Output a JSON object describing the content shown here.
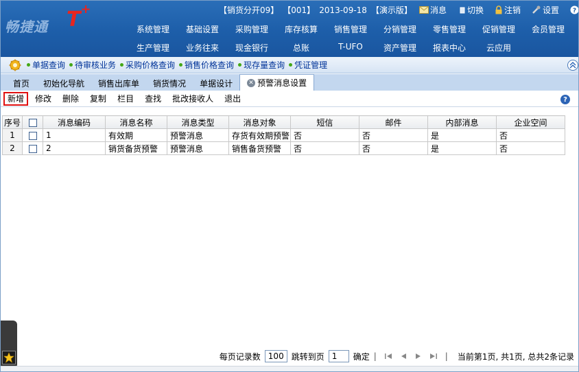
{
  "header": {
    "logo_text": "畅捷通",
    "logo_brand": "T",
    "logo_plus": "+",
    "info": [
      "【销货分开09】",
      "【001】",
      "2013-09-18",
      "【演示版】"
    ],
    "buttons": {
      "message": "消息",
      "switch": "切换",
      "logout": "注销",
      "settings": "设置",
      "help": "帮助"
    },
    "nav_row1": [
      "系统管理",
      "基础设置",
      "采购管理",
      "库存核算",
      "销售管理",
      "分销管理",
      "零售管理",
      "促销管理",
      "会员管理"
    ],
    "nav_row2": [
      "生产管理",
      "业务往来",
      "现金银行",
      "总账",
      "T-UFO",
      "资产管理",
      "报表中心",
      "云应用"
    ]
  },
  "quickbar": [
    "单据查询",
    "待审核业务",
    "采购价格查询",
    "销售价格查询",
    "现存量查询",
    "凭证管理"
  ],
  "tabs": [
    "首页",
    "初始化导航",
    "销售出库单",
    "销货情况",
    "单据设计",
    "预警消息设置"
  ],
  "toolbar": [
    "新增",
    "修改",
    "删除",
    "复制",
    "栏目",
    "查找",
    "批改接收人",
    "退出"
  ],
  "grid": {
    "headers": [
      "序号",
      "",
      "消息编码",
      "消息名称",
      "消息类型",
      "消息对象",
      "短信",
      "邮件",
      "内部消息",
      "企业空间"
    ],
    "rows": [
      [
        "1",
        "",
        "1",
        "有效期",
        "预警消息",
        "存货有效期预警",
        "否",
        "否",
        "是",
        "否"
      ],
      [
        "2",
        "",
        "2",
        "销货备货预警",
        "预警消息",
        "销售备货预警",
        "否",
        "否",
        "是",
        "否"
      ]
    ]
  },
  "pager": {
    "per_page_label": "每页记录数",
    "per_page_value": "100",
    "jump_label": "跳转到页",
    "jump_value": "1",
    "confirm": "确定",
    "status": "当前第1页, 共1页, 总共2条记录"
  },
  "colors": {
    "header_bg": "#1d5ea9",
    "accent_red": "#e01010",
    "quick_link": "#003399"
  }
}
